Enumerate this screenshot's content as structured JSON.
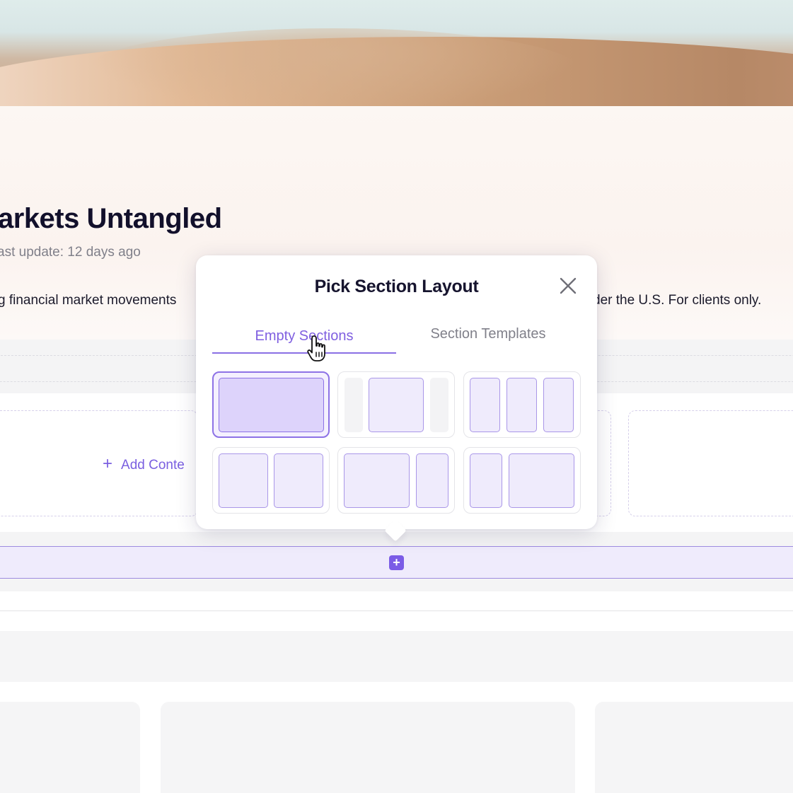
{
  "page": {
    "title": "arkets Untangled",
    "last_update": "ast update: 12 days ago",
    "description_left": "g financial market movements",
    "description_right": "der the U.S. For clients only."
  },
  "editor": {
    "add_content_label": "Add Conte",
    "add_section_button": "+"
  },
  "popover": {
    "title": "Pick Section Layout",
    "close_icon": "close-icon",
    "tabs": [
      {
        "label": "Empty Sections",
        "active": true
      },
      {
        "label": "Section Templates",
        "active": false
      }
    ],
    "layouts": [
      {
        "name": "single-column",
        "selected": true
      },
      {
        "name": "centered-with-margins",
        "selected": false
      },
      {
        "name": "three-columns",
        "selected": false
      },
      {
        "name": "two-columns-equal",
        "selected": false
      },
      {
        "name": "two-columns-wide-left",
        "selected": false
      },
      {
        "name": "two-columns-wide-right",
        "selected": false
      }
    ]
  },
  "colors": {
    "accent": "#7b5ce6",
    "accent_light": "#efebfc",
    "text_dark": "#12102b",
    "text_muted": "#80808a"
  }
}
